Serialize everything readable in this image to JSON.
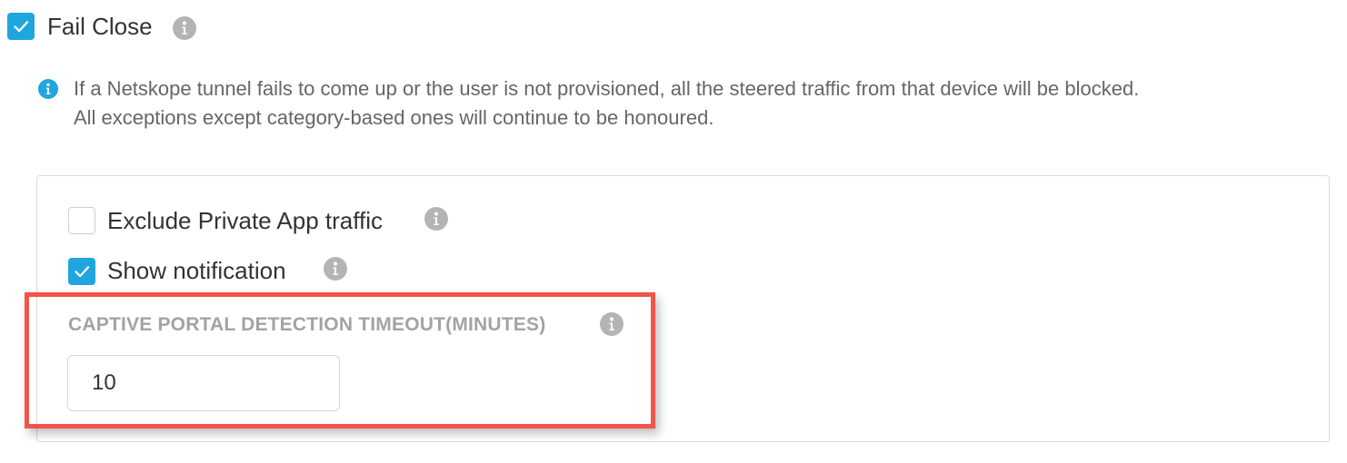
{
  "fail_close": {
    "label": "Fail Close",
    "checked": true,
    "info_icon": "info-icon"
  },
  "note": {
    "icon": "info-icon",
    "text": "If a Netskope tunnel fails to come up or the user is not provisioned, all the steered traffic from that device will be blocked. All exceptions except category-based ones will continue to be honoured."
  },
  "panel": {
    "exclude_private_app": {
      "label": "Exclude Private App traffic",
      "checked": false,
      "info_icon": "info-icon"
    },
    "show_notification": {
      "label": "Show notification",
      "checked": true,
      "info_icon": "info-icon"
    },
    "captive_portal": {
      "label": "CAPTIVE PORTAL DETECTION TIMEOUT(MINUTES)",
      "value": "10",
      "info_icon": "info-icon"
    }
  },
  "colors": {
    "accent": "#1fa6df",
    "highlight": "#f15449",
    "info_gray": "#b4b4b4"
  }
}
